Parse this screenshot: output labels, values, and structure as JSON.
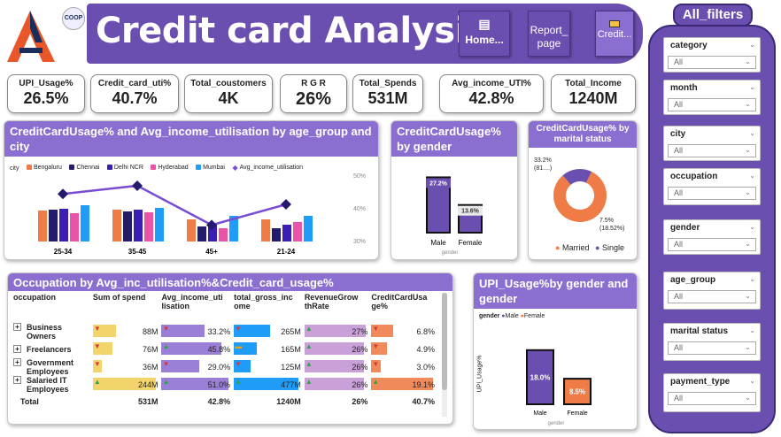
{
  "header": {
    "title": "Credit card Analysis",
    "logo_badge": "COOP",
    "nav": [
      {
        "label": "Home..."
      },
      {
        "label": "Report_ page"
      },
      {
        "label": "Credit..."
      }
    ]
  },
  "kpis": [
    {
      "label": "UPI_Usage%",
      "value": "26.5%"
    },
    {
      "label": "Credit_card_uti%",
      "value": "40.7%"
    },
    {
      "label": "Total_coustomers",
      "value": "4K"
    },
    {
      "label": "R G R",
      "value": "26%"
    },
    {
      "label": "Total_Spends",
      "value": "531M"
    },
    {
      "label": "Avg_income_UTI%",
      "value": "42.8%"
    },
    {
      "label": "Total_Income",
      "value": "1240M"
    }
  ],
  "filters_panel": {
    "title": "All_filters",
    "filters": [
      {
        "label": "category",
        "value": "All"
      },
      {
        "label": "month",
        "value": "All"
      },
      {
        "label": "city",
        "value": "All"
      },
      {
        "label": "occupation",
        "value": "All"
      },
      {
        "label": "gender",
        "value": "All"
      },
      {
        "label": "age_group",
        "value": "All"
      },
      {
        "label": "marital status",
        "value": "All"
      },
      {
        "label": "payment_type",
        "value": "All"
      }
    ]
  },
  "age_chart": {
    "title": "CreditCardUsage% and Avg_income_utilisation by age_group and city",
    "legend_title": "city",
    "colors": {
      "Bengaluru": "#ef7c47",
      "Chennai": "#241a6e",
      "Delhi NCR": "#3b1fb5",
      "Hyderabad": "#ea54a8",
      "Mumbai": "#1e9cf7",
      "line": "#7a4bd3"
    }
  },
  "gender_chart": {
    "title": "CreditCardUsage% by gender",
    "xlabel": "gender"
  },
  "marital_chart": {
    "title": "CreditCardUsage% by marital status",
    "label_married": "33.2% (81....)",
    "label_single": "7.5% (18.52%)",
    "legend": [
      {
        "name": "Married",
        "color": "#ef7c47"
      },
      {
        "name": "Single",
        "color": "#6b4fb0"
      }
    ]
  },
  "upi_chart": {
    "title": "UPI_Usage%by gender and gender",
    "legend_title": "gender",
    "ylabel": "UPI_Usage%",
    "xlabel": "gender"
  },
  "occupation_table": {
    "title": "Occupation by Avg_inc_utilisation%&Credit_card_usage%",
    "columns": [
      "occupation",
      "Sum of spend",
      "Avg_income_uti lisation",
      "total_gross_inc ome",
      "RevenueGrow thRate",
      "CreditCardUsa ge%"
    ],
    "rows": [
      {
        "name": "Business Owners",
        "spend": "88M",
        "avg": "33.2%",
        "gross": "265M",
        "rgr": "27%",
        "ccu": "6.8%"
      },
      {
        "name": "Freelancers",
        "spend": "76M",
        "avg": "45.8%",
        "gross": "165M",
        "rgr": "26%",
        "ccu": "4.9%"
      },
      {
        "name": "Government Employees",
        "spend": "36M",
        "avg": "29.0%",
        "gross": "125M",
        "rgr": "26%",
        "ccu": "3.0%"
      },
      {
        "name": "Salaried IT Employees",
        "spend": "244M",
        "avg": "51.0%",
        "gross": "477M",
        "rgr": "26%",
        "ccu": "19.1%"
      }
    ],
    "total": {
      "name": "Total",
      "spend": "531M",
      "avg": "42.8%",
      "gross": "1240M",
      "rgr": "26%",
      "ccu": "40.7%"
    }
  },
  "chart_data": [
    {
      "type": "bar",
      "title": "CreditCardUsage% and Avg_income_utilisation by age_group and city",
      "categories": [
        "25-34",
        "35-45",
        "45+",
        "21-24"
      ],
      "series": [
        {
          "name": "Bengaluru",
          "values": [
            3.5,
            3.6,
            2.5,
            2.5
          ]
        },
        {
          "name": "Chennai",
          "values": [
            3.6,
            3.4,
            1.7,
            1.5
          ]
        },
        {
          "name": "Delhi NCR",
          "values": [
            3.7,
            3.6,
            1.9,
            1.9
          ]
        },
        {
          "name": "Hyderabad",
          "values": [
            3.2,
            3.3,
            1.5,
            2.2
          ]
        },
        {
          "name": "Mumbai",
          "values": [
            4.1,
            3.8,
            2.9,
            2.9
          ]
        },
        {
          "name": "Avg_income_utilisation",
          "values": [
            44,
            46.5,
            34.5,
            40.8
          ]
        }
      ],
      "y2_ticks": [
        "50%",
        "40%",
        "30%"
      ],
      "ylim2": [
        30,
        50
      ]
    },
    {
      "type": "bar",
      "title": "CreditCardUsage% by gender",
      "categories": [
        "Male",
        "Female"
      ],
      "values": [
        27.2,
        13.6
      ],
      "labels": [
        "27.2%",
        "13.6%"
      ],
      "xlabel": "gender"
    },
    {
      "type": "pie",
      "title": "CreditCardUsage% by marital status",
      "categories": [
        "Married",
        "Single"
      ],
      "values": [
        33.2,
        7.5
      ]
    },
    {
      "type": "bar",
      "title": "UPI_Usage%by gender and gender",
      "categories": [
        "Male",
        "Female"
      ],
      "series": [
        {
          "name": "Male",
          "values": [
            18.0,
            null
          ]
        },
        {
          "name": "Female",
          "values": [
            null,
            8.5
          ]
        }
      ],
      "labels": [
        "18.0%",
        "8.5%"
      ],
      "xlabel": "gender",
      "ylabel": "UPI_Usage%"
    }
  ]
}
